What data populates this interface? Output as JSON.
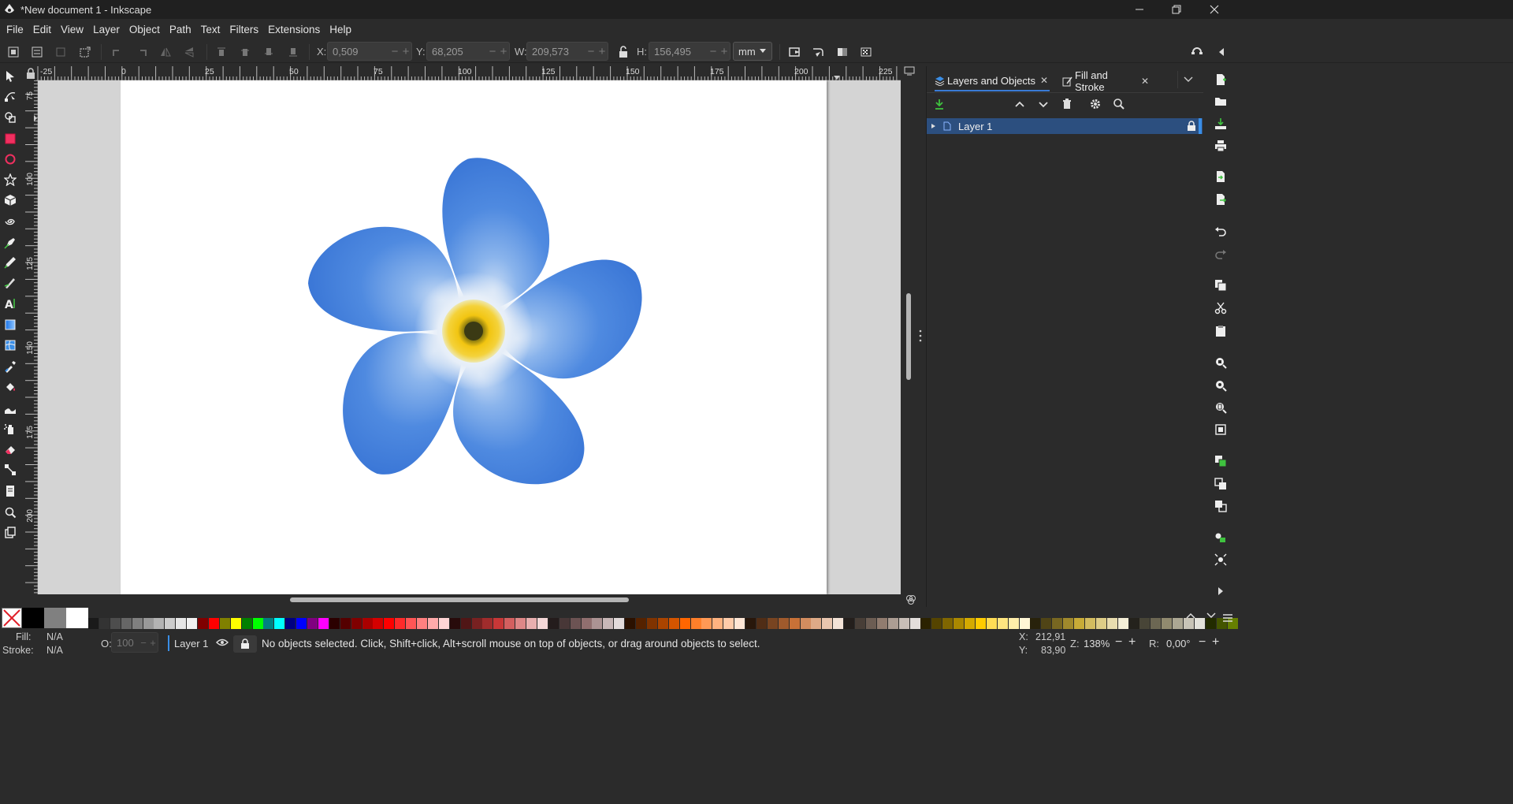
{
  "window": {
    "title": "*New document 1 - Inkscape",
    "minimize_icon": "minimize-icon",
    "maximize_icon": "restore-icon",
    "close_icon": "close-icon"
  },
  "menu": [
    "File",
    "Edit",
    "View",
    "Layer",
    "Object",
    "Path",
    "Text",
    "Filters",
    "Extensions",
    "Help"
  ],
  "toolbar": {
    "x_label": "X:",
    "x_value": "0,509",
    "y_label": "Y:",
    "y_value": "68,205",
    "w_label": "W:",
    "w_value": "209,573",
    "h_label": "H:",
    "h_value": "156,495",
    "unit": "mm"
  },
  "ruler": {
    "h_ticks": [
      "-25",
      "0",
      "25",
      "50",
      "75",
      "100",
      "125",
      "150",
      "175",
      "200",
      "225"
    ],
    "v_ticks": [
      "75",
      "100",
      "125",
      "150",
      "175",
      "200"
    ]
  },
  "panel": {
    "tabs": [
      {
        "label": "Layers and Objects",
        "icon": "layers-icon",
        "active": true
      },
      {
        "label": "Fill and Stroke",
        "icon": "paintbrush-icon",
        "active": false
      }
    ],
    "layers": [
      {
        "name": "Layer 1",
        "locked": true,
        "selected": true
      }
    ]
  },
  "statusbar": {
    "fill_label": "Fill:",
    "fill_value": "N/A",
    "stroke_label": "Stroke:",
    "stroke_value": "N/A",
    "opacity_label": "O:",
    "opacity_value": "100",
    "layer": "Layer 1",
    "message": "No objects selected. Click, Shift+click, Alt+scroll mouse on top of objects, or drag around objects to select.",
    "x_label": "X:",
    "x_value": "212,91",
    "y_label": "Y:",
    "y_value": "83,90",
    "zoom_label": "Z:",
    "zoom_value": "138%",
    "rotation_label": "R:",
    "rotation_value": "0,00°"
  },
  "palette": [
    "#000000",
    "#808080",
    "#ffffff",
    "#1a1a1a",
    "#333333",
    "#4d4d4d",
    "#666666",
    "#808080",
    "#999999",
    "#b3b3b3",
    "#cccccc",
    "#e6e6e6",
    "#f2f2f2",
    "#800000",
    "#ff0000",
    "#808000",
    "#ffff00",
    "#008000",
    "#00ff00",
    "#008080",
    "#00ffff",
    "#000080",
    "#0000ff",
    "#800080",
    "#ff00ff",
    "#2b0000",
    "#550000",
    "#800000",
    "#aa0000",
    "#d40000",
    "#ff0000",
    "#ff2a2a",
    "#ff5555",
    "#ff8080",
    "#ffaaaa",
    "#ffd5d5",
    "#280b0b",
    "#501616",
    "#782121",
    "#a02c2c",
    "#c83737",
    "#d35f5f",
    "#de8787",
    "#e9afaf",
    "#f4d7d7",
    "#241c1c",
    "#483737",
    "#6c5353",
    "#916f6f",
    "#ac9393",
    "#c8b7b7",
    "#e3dbdb",
    "#2b1100",
    "#552200",
    "#803300",
    "#aa4400",
    "#d45500",
    "#ff6600",
    "#ff7f2a",
    "#ff9955",
    "#ffb380",
    "#ffccaa",
    "#ffe6d5",
    "#28170b",
    "#502d16",
    "#784421",
    "#a05a2c",
    "#c87137",
    "#d38d5f",
    "#deaa87",
    "#e9c6af",
    "#f4e3d7",
    "#241f1c",
    "#483e37",
    "#6c5d53",
    "#917c6f",
    "#ac9d93",
    "#c8beb7",
    "#e3dedb",
    "#2b2200",
    "#554400",
    "#806600",
    "#aa8800",
    "#d4aa00",
    "#ffcc00",
    "#ffdd55",
    "#ffe680",
    "#ffeeaa",
    "#fff6d5",
    "#28220b",
    "#504416",
    "#786721",
    "#a0892c",
    "#c8ab37",
    "#d3bc5f",
    "#decd87",
    "#e9ddaf",
    "#f4eed7",
    "#24221c",
    "#484537",
    "#6c6753",
    "#918a6f",
    "#aca793",
    "#c8c4b7",
    "#e3e2db",
    "#222b00",
    "#445500",
    "#668000"
  ]
}
